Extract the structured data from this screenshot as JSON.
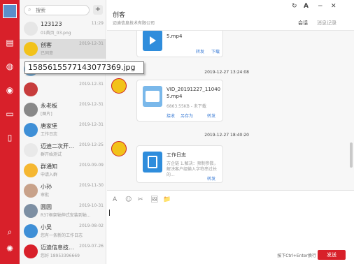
{
  "search": {
    "placeholder": "搜索"
  },
  "add_label": "+",
  "tooltip_text": "1585615577143077369.jpg",
  "contacts": [
    {
      "name": "123123",
      "date": "11:29",
      "msg": "01首页_03.png",
      "color": "#e6e6e6"
    },
    {
      "name": "创客",
      "date": "2019-12-31",
      "msg": "已同意",
      "color": "#f2c21a"
    },
    {
      "name": "",
      "date": "",
      "msg": "",
      "color": "#7fb0d6"
    },
    {
      "name": "",
      "date": "2019-12-31",
      "msg": "",
      "color": "#c73c3c"
    },
    {
      "name": "永老板",
      "date": "2019-12-31",
      "msg": "[图片]",
      "color": "#888888"
    },
    {
      "name": "唐家堡",
      "date": "2019-12-31",
      "msg": "工作日志",
      "color": "#3f8fd6"
    },
    {
      "name": "迈迪二次开...",
      "date": "2019-12-25",
      "msg": "群开始测试",
      "color": "#e9e9e9"
    },
    {
      "name": "群通知",
      "date": "2019-09-09",
      "msg": "申请入群",
      "color": "#f5b731"
    },
    {
      "name": "小孙",
      "date": "2019-11-30",
      "msg": "审批",
      "color": "#c8a28a"
    },
    {
      "name": "圆圆",
      "date": "2019-10-31",
      "msg": "R37框架轴伸式安装到轴...",
      "color": "#7d8fa3"
    },
    {
      "name": "小吴",
      "date": "2019-08-02",
      "msg": "您有一条新的工作日志",
      "color": "#3f8fd6"
    },
    {
      "name": "迈迪信息技...",
      "date": "2019-07-26",
      "msg": "您好 18953396669",
      "color": "#d8202a"
    }
  ],
  "header": {
    "title": "创客",
    "subtitle": "迈迪信息技术有限公司",
    "tab_chat": "会话",
    "tab_history": "消息记录",
    "refresh_icon": "↻",
    "font_icon": "A",
    "minimize_icon": "−",
    "close_icon": "✕"
  },
  "messages": [
    {
      "time": "",
      "filename": "5.mp4",
      "size": "",
      "actions": [
        "转发",
        "下载"
      ]
    },
    {
      "time": "2019-12-27 13:24:08",
      "filename": "VID_20191227_110405.mp4",
      "size": "6863.55KB - 未下载",
      "actions": [
        "接收",
        "另存为",
        "转发"
      ]
    },
    {
      "time": "2019-12-27 18:40:20",
      "card_title": "工作日志",
      "card_desc": "万企链 1.解决：预制参数，解决客户组输入字符串过长的...",
      "actions": [
        "转发"
      ]
    }
  ],
  "tools": [
    "A",
    "☺",
    "✂",
    "🖼",
    "📁"
  ],
  "footer": {
    "hint": "按下Ctrl+Enter换行",
    "send": "发送"
  },
  "colors": {
    "brand": "#d8202a",
    "link": "#3a7bd5",
    "file_blue": "#2f8ddc"
  }
}
